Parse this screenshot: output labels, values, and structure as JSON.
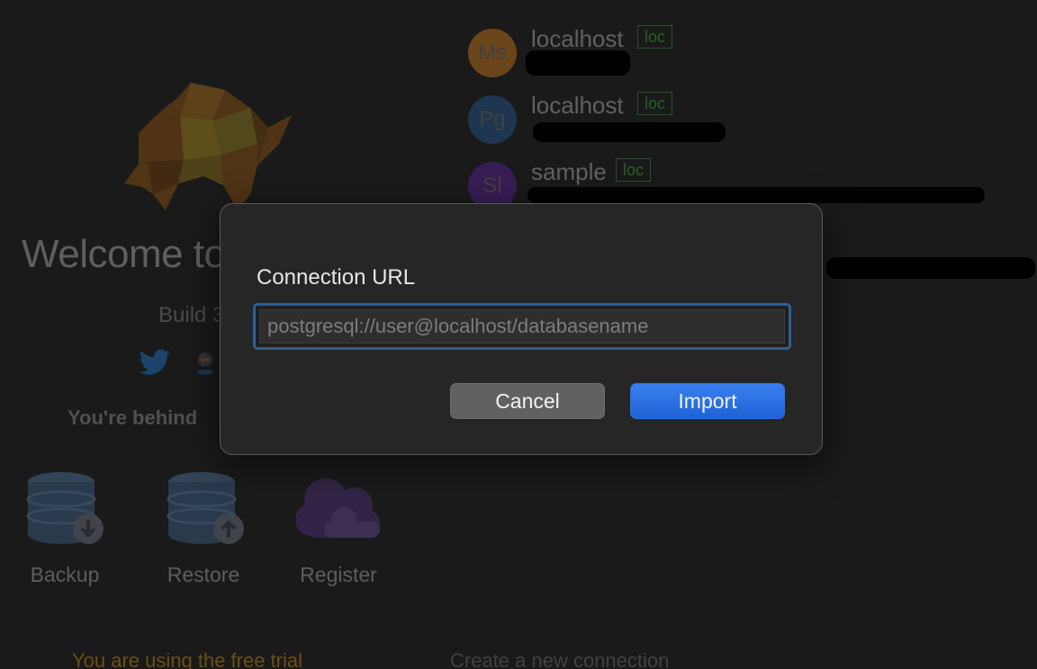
{
  "welcome": {
    "title": "Welcome to",
    "build_label": "Build 3",
    "update_notice": "You're behind",
    "trial_text": "You are using the free trial"
  },
  "tools": [
    {
      "label": "Backup",
      "icon": "database-download-icon"
    },
    {
      "label": "Restore",
      "icon": "database-upload-icon"
    },
    {
      "label": "Register",
      "icon": "cloud-icon"
    }
  ],
  "social": [
    "twitter-icon",
    "github-icon"
  ],
  "connections": [
    {
      "initials": "Ms",
      "name": "localhost",
      "tag": "loc",
      "color": "#8a5a22"
    },
    {
      "initials": "Pg",
      "name": "localhost",
      "tag": "loc",
      "color": "#27496b"
    },
    {
      "initials": "Sl",
      "name": "sample",
      "tag": "loc",
      "color": "#4a2770"
    }
  ],
  "create_link": "Create a new connection",
  "dialog": {
    "title": "Connection URL",
    "url_placeholder": "postgresql://user@localhost/databasename",
    "url_value": "",
    "cancel_label": "Cancel",
    "import_label": "Import"
  },
  "colors": {
    "accent": "#2767dc",
    "tag_green": "#2f6f2f",
    "focus_ring": "#2d5f91"
  }
}
